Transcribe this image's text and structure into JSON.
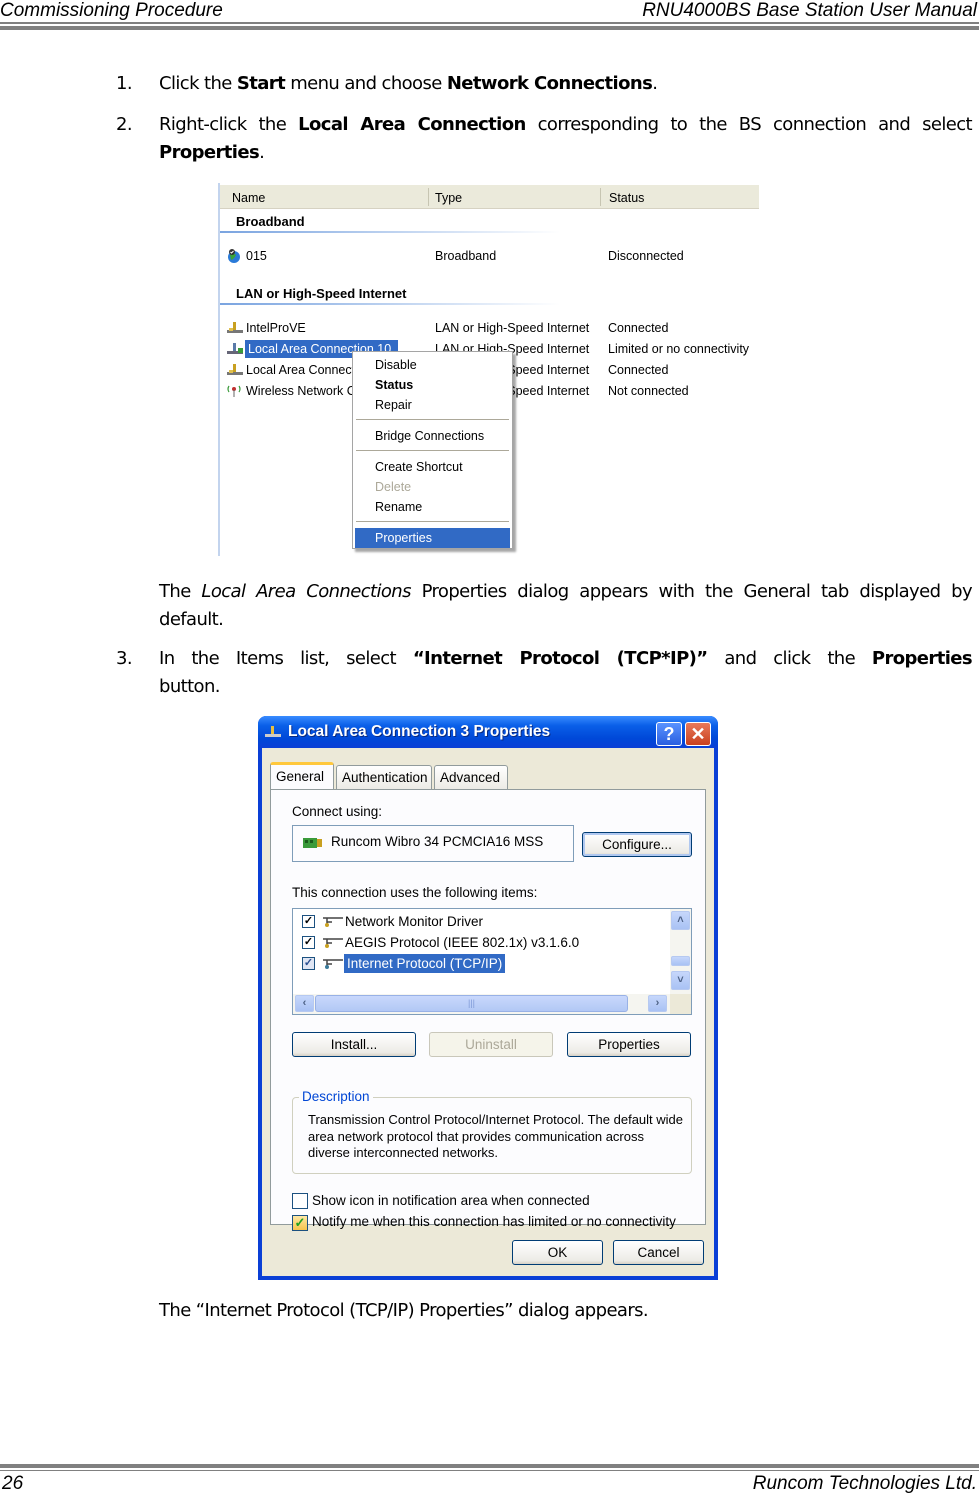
{
  "header": {
    "left": "Commissioning Procedure",
    "right": "RNU4000BS Base Station User Manual"
  },
  "footer": {
    "page_number": "26",
    "company": "Runcom Technologies Ltd."
  },
  "steps": [
    {
      "num": "1.",
      "pre": "Click the ",
      "b1": "Start",
      "mid": " menu and choose ",
      "b2": "Network Connections",
      "post": "."
    },
    {
      "num": "2.",
      "pre": "Right-click the ",
      "b1": "Local Area Connection",
      "mid": " corresponding to the BS connection and select ",
      "b2": "Properties",
      "post": "."
    },
    {
      "num": "3.",
      "pre": "In the Items list, select ",
      "b1": "“Internet Protocol (TCP*IP)”",
      "mid": " and click the ",
      "b2": "Properties",
      "post": " button."
    }
  ],
  "para_after_shot1": {
    "pre": "The ",
    "italic": "Local Area Connections",
    "post": " Properties dialog appears with the General tab displayed by default."
  },
  "para_after_shot2": "The “Internet Protocol (TCP/IP) Properties” dialog appears.",
  "network_connections": {
    "columns": [
      "Name",
      "Type",
      "Status"
    ],
    "groups": [
      {
        "title": "Broadband",
        "rows": [
          {
            "icon": "globe-icon",
            "name": "015",
            "type": "Broadband",
            "status": "Disconnected"
          }
        ]
      },
      {
        "title": "LAN or High-Speed Internet",
        "rows": [
          {
            "icon": "lan-icon",
            "name": "IntelProVE",
            "type": "LAN or High-Speed Internet",
            "status": "Connected"
          },
          {
            "icon": "lan-icon",
            "name": "Local Area Connection 10",
            "type": "LAN or High-Speed Internet",
            "status": "Limited or no connectivity",
            "selected": true
          },
          {
            "icon": "lan-icon",
            "name": "Local Area Connection",
            "type": "LAN or High-Speed Internet",
            "status": "Connected"
          },
          {
            "icon": "wireless-icon",
            "name": "Wireless Network Connection",
            "type": "LAN or High-Speed Internet",
            "status": "Not connected"
          }
        ]
      }
    ],
    "context_menu": [
      {
        "label": "Disable"
      },
      {
        "label": "Status",
        "bold": true
      },
      {
        "label": "Repair"
      },
      {
        "label": "Bridge Connections"
      },
      {
        "label": "Create Shortcut"
      },
      {
        "label": "Delete",
        "disabled": true
      },
      {
        "label": "Rename"
      },
      {
        "label": "Properties",
        "highlighted": true
      }
    ]
  },
  "dialog": {
    "title": "Local Area Connection 3 Properties",
    "help_glyph": "?",
    "close_glyph": "✕",
    "tabs": [
      "General",
      "Authentication",
      "Advanced"
    ],
    "active_tab": "General",
    "connect_using_label": "Connect using:",
    "adapter_name": "Runcom Wibro 34 PCMCIA16 MSS",
    "configure_button": "Configure...",
    "items_label": "This connection uses the following items:",
    "items": [
      {
        "label": "Network Monitor Driver",
        "checked": true
      },
      {
        "label": "AEGIS Protocol (IEEE 802.1x) v3.1.6.0",
        "checked": true
      },
      {
        "label": "Internet Protocol (TCP/IP)",
        "checked": true,
        "selected": true
      }
    ],
    "install_button": "Install...",
    "uninstall_button": "Uninstall",
    "properties_button": "Properties",
    "description_legend": "Description",
    "description_text": "Transmission Control Protocol/Internet Protocol. The default wide area network protocol that provides communication across diverse interconnected networks.",
    "show_icon_label": "Show icon in notification area when connected",
    "show_icon_checked": false,
    "notify_label": "Notify me when this connection has limited or no connectivity",
    "notify_checked": true,
    "ok_button": "OK",
    "cancel_button": "Cancel"
  }
}
